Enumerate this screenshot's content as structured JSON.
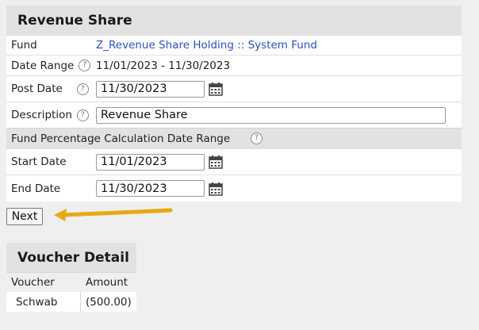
{
  "panel": {
    "title": "Revenue Share",
    "fund": {
      "label": "Fund",
      "value": "Z_Revenue Share Holding :: System Fund"
    },
    "date_range": {
      "label": "Date Range",
      "value": "11/01/2023 - 11/30/2023"
    },
    "post_date": {
      "label": "Post Date",
      "value": "11/30/2023"
    },
    "description": {
      "label": "Description",
      "value": "Revenue Share"
    },
    "section": {
      "label": "Fund Percentage Calculation Date Range"
    },
    "start_date": {
      "label": "Start Date",
      "value": "11/01/2023"
    },
    "end_date": {
      "label": "End Date",
      "value": "11/30/2023"
    },
    "help_glyph": "?"
  },
  "next_button": {
    "label": "Next"
  },
  "voucher": {
    "title": "Voucher Detail",
    "columns": [
      "Voucher",
      "Amount"
    ],
    "rows": [
      [
        "Schwab",
        "(500.00)"
      ]
    ]
  },
  "colors": {
    "link": "#2a52be",
    "arrow": "#f0b429"
  },
  "icons": {
    "calendar": "calendar-icon",
    "help": "help-icon",
    "arrow": "arrow-left-icon"
  }
}
